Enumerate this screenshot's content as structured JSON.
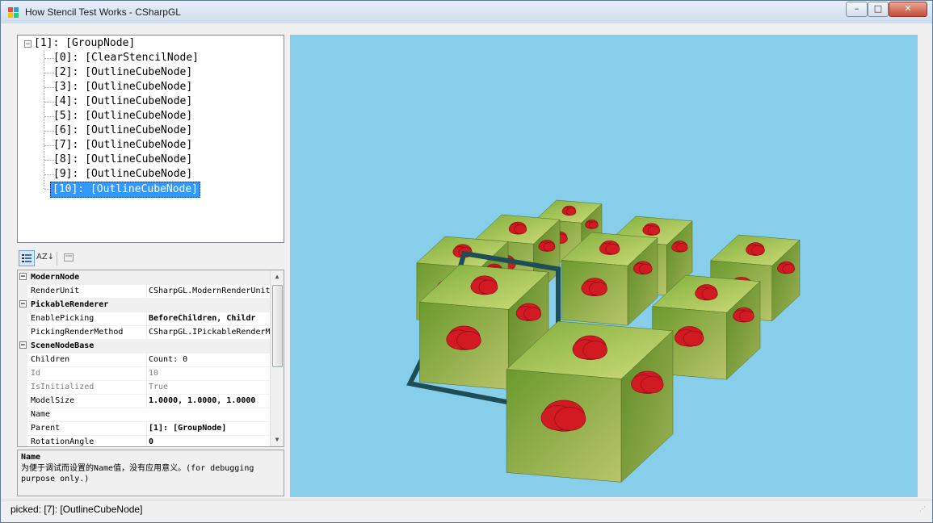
{
  "window": {
    "title": "How Stencil Test Works - CSharpGL",
    "controls": {
      "minimize": "–",
      "maximize": "□",
      "close": "✕"
    }
  },
  "tree": {
    "root": "[1]: [GroupNode]",
    "expander": "−",
    "children": [
      {
        "label": "[0]: [ClearStencilNode]",
        "selected": false
      },
      {
        "label": "[2]: [OutlineCubeNode]",
        "selected": false
      },
      {
        "label": "[3]: [OutlineCubeNode]",
        "selected": false
      },
      {
        "label": "[4]: [OutlineCubeNode]",
        "selected": false
      },
      {
        "label": "[5]: [OutlineCubeNode]",
        "selected": false
      },
      {
        "label": "[6]: [OutlineCubeNode]",
        "selected": false
      },
      {
        "label": "[7]: [OutlineCubeNode]",
        "selected": false
      },
      {
        "label": "[8]: [OutlineCubeNode]",
        "selected": false
      },
      {
        "label": "[9]: [OutlineCubeNode]",
        "selected": false
      },
      {
        "label": "[10]: [OutlineCubeNode]",
        "selected": true
      }
    ]
  },
  "property_toolbar": {
    "categorized_icon": "categorized-icon",
    "alphabetical_label": "AZ↓",
    "pages_icon": "property-pages-icon"
  },
  "property_grid": {
    "rows": [
      {
        "kind": "category",
        "name": "ModernNode"
      },
      {
        "kind": "prop",
        "name": "RenderUnit",
        "value": "CSharpGL.ModernRenderUnit",
        "style": ""
      },
      {
        "kind": "category",
        "name": "PickableRenderer"
      },
      {
        "kind": "prop",
        "name": "EnablePicking",
        "value": "BeforeChildren, Childr",
        "style": "bold"
      },
      {
        "kind": "prop",
        "name": "PickingRenderMethod",
        "value": "CSharpGL.IPickableRenderMe",
        "style": ""
      },
      {
        "kind": "category",
        "name": "SceneNodeBase"
      },
      {
        "kind": "prop",
        "name": "Children",
        "value": "Count: 0",
        "style": ""
      },
      {
        "kind": "prop",
        "name": "Id",
        "value": "10",
        "style": "gray"
      },
      {
        "kind": "prop",
        "name": "IsInitialized",
        "value": "True",
        "style": "gray"
      },
      {
        "kind": "prop",
        "name": "ModelSize",
        "value": "1.0000, 1.0000, 1.0000",
        "style": "bold"
      },
      {
        "kind": "prop",
        "name": "Name",
        "value": "",
        "style": ""
      },
      {
        "kind": "prop",
        "name": "Parent",
        "value": "[1]: [GroupNode]",
        "style": "bold"
      },
      {
        "kind": "prop",
        "name": "RotationAngle",
        "value": "0",
        "style": "bold"
      }
    ],
    "collapse_glyph": "−"
  },
  "help": {
    "title": "Name",
    "description": "为便于调试而设置的Name值，没有应用意义。(for debugging purpose only.)"
  },
  "viewport": {
    "background": "#87ceeb",
    "outline_color": "#1d4e56"
  },
  "status": {
    "text": "picked: [7]: [OutlineCubeNode]"
  }
}
